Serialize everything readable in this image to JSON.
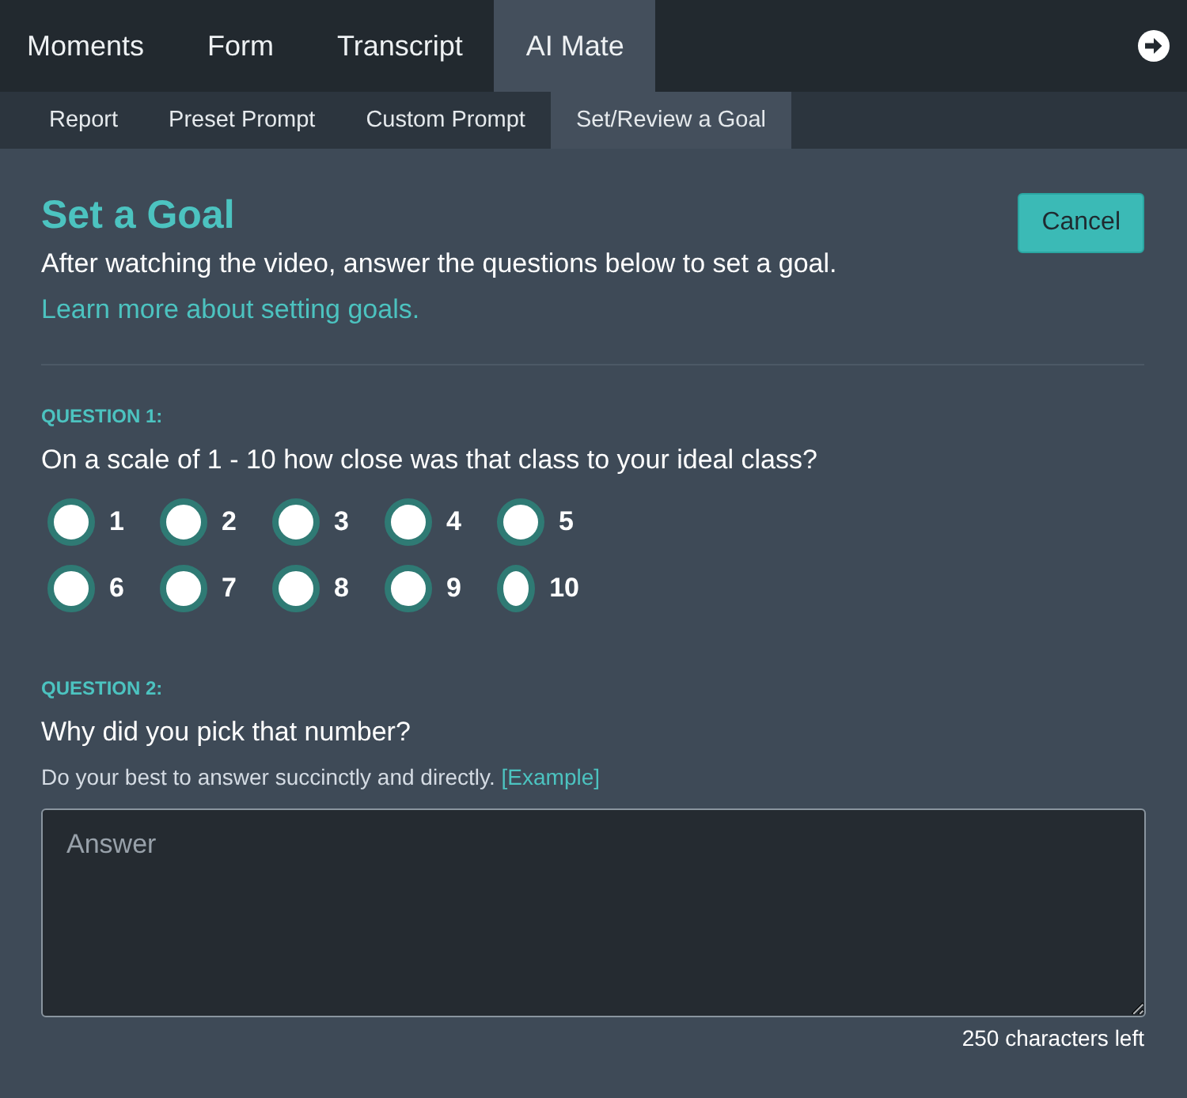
{
  "tabs": [
    {
      "label": "Moments",
      "selected": false
    },
    {
      "label": "Form",
      "selected": false
    },
    {
      "label": "Transcript",
      "selected": false
    },
    {
      "label": "AI Mate",
      "selected": true
    }
  ],
  "subtabs": [
    {
      "label": "Report",
      "selected": false
    },
    {
      "label": "Preset Prompt",
      "selected": false
    },
    {
      "label": "Custom Prompt",
      "selected": false
    },
    {
      "label": "Set/Review a Goal",
      "selected": true
    }
  ],
  "goal": {
    "title": "Set a Goal",
    "cancel_button": "Cancel",
    "intro": "After watching the video, answer the questions below to set a goal.",
    "learn_more_link": "Learn more about setting goals."
  },
  "question_1": {
    "label": "QUESTION 1:",
    "text": "On a scale of 1 - 10 how close was that class to your ideal class?",
    "options": [
      {
        "label": "1",
        "selected": false
      },
      {
        "label": "2",
        "selected": false
      },
      {
        "label": "3",
        "selected": false
      },
      {
        "label": "4",
        "selected": false
      },
      {
        "label": "5",
        "selected": false
      },
      {
        "label": "6",
        "selected": false
      },
      {
        "label": "7",
        "selected": false
      },
      {
        "label": "8",
        "selected": false
      },
      {
        "label": "9",
        "selected": false
      },
      {
        "label": "10",
        "selected": false
      }
    ]
  },
  "question_2": {
    "label": "QUESTION 2:",
    "text": "Why did you pick that number?",
    "hint": "Do your best to answer succinctly and directly.",
    "example_link": "[Example]",
    "answer": {
      "placeholder": "Answer"
    },
    "counter": "250 characters left"
  }
}
